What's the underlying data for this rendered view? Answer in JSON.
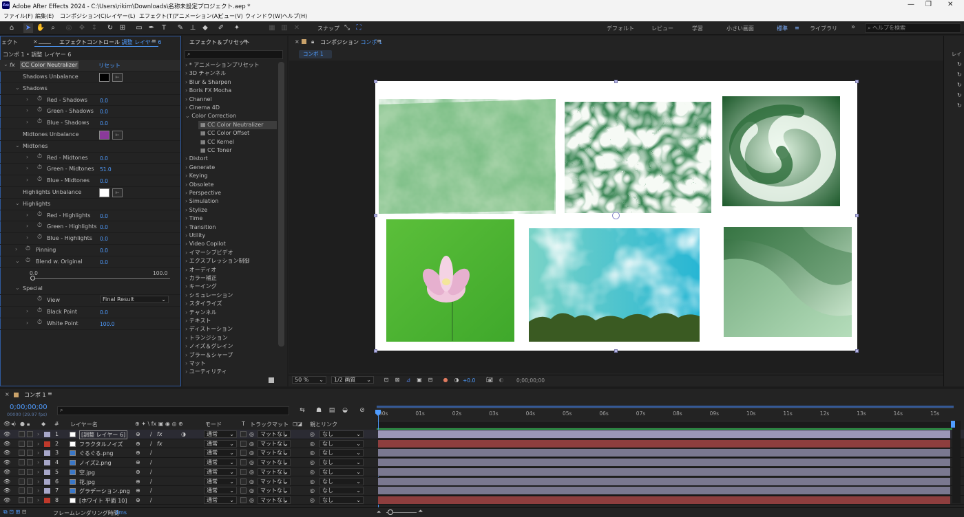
{
  "window": {
    "title": "Adobe After Effects 2024 - C:\\Users\\rikim\\Downloads\\名称未設定プロジェクト.aep *",
    "logo_text": "Ae",
    "minimize": "—",
    "maximize": "❐",
    "close": "✕"
  },
  "menu": [
    "ファイル(F)",
    "編集(E)",
    "コンポジション(C)",
    "レイヤー(L)",
    "エフェクト(T)",
    "アニメーション(A)",
    "ビュー(V)",
    "ウィンドウ(W)",
    "ヘルプ(H)"
  ],
  "toolbar": {
    "snap_label": "スナップ",
    "workspaces": [
      "デフォルト",
      "レビュー",
      "学習",
      "小さい画面",
      "標準",
      "ライブラリ"
    ],
    "active_workspace": "標準",
    "more": "»",
    "help_search_placeholder": "ヘルプを検索"
  },
  "effect_controls": {
    "left_stub": "ェクト",
    "tab_label": "エフェクトコントロール",
    "tab_layer": "調整 レイヤー 6",
    "breadcrumb": "コンポ 1 • 調整 レイヤー 6",
    "effect_name": "CC Color Neutralizer",
    "reset": "リセット",
    "rows": [
      {
        "label": "Shadows Unbalance",
        "kind": "color",
        "color": "#000000"
      },
      {
        "label": "Shadows",
        "kind": "group"
      },
      {
        "label": "Red - Shadows",
        "kind": "param",
        "value": "0.0"
      },
      {
        "label": "Green - Shadows",
        "kind": "param",
        "value": "0.0"
      },
      {
        "label": "Blue - Shadows",
        "kind": "param",
        "value": "0.0"
      },
      {
        "label": "Midtones Unbalance",
        "kind": "color",
        "color": "#8a3a9a"
      },
      {
        "label": "Midtones",
        "kind": "group"
      },
      {
        "label": "Red - Midtones",
        "kind": "param",
        "value": "0.0"
      },
      {
        "label": "Green - Midtones",
        "kind": "param",
        "value": "51.0"
      },
      {
        "label": "Blue - Midtones",
        "kind": "param",
        "value": "0.0"
      },
      {
        "label": "Highlights Unbalance",
        "kind": "color",
        "color": "#ffffff"
      },
      {
        "label": "Highlights",
        "kind": "group"
      },
      {
        "label": "Red - Highlights",
        "kind": "param",
        "value": "0.0"
      },
      {
        "label": "Green - Highlights",
        "kind": "param",
        "value": "0.0"
      },
      {
        "label": "Blue - Highlights",
        "kind": "param",
        "value": "0.0"
      },
      {
        "label": "Pinning",
        "kind": "top",
        "value": "0.0"
      },
      {
        "label": "Blend w. Original",
        "kind": "top",
        "value": "0.0"
      }
    ],
    "slider": {
      "min": "0.0",
      "max": "100.0",
      "value": 0
    },
    "special_label": "Special",
    "view_label": "View",
    "view_value": "Final Result",
    "black_point_label": "Black Point",
    "black_point_value": "0.0",
    "white_point_label": "White Point",
    "white_point_value": "100.0"
  },
  "effects_presets": {
    "tab_label": "エフェクト＆プリセット",
    "search_icon": "⌕",
    "items": [
      {
        "label": "* アニメーションプリセット",
        "level": 0,
        "open": false
      },
      {
        "label": "3D チャンネル",
        "level": 0,
        "open": false
      },
      {
        "label": "Blur & Sharpen",
        "level": 0,
        "open": false
      },
      {
        "label": "Boris FX Mocha",
        "level": 0,
        "open": false
      },
      {
        "label": "Channel",
        "level": 0,
        "open": false
      },
      {
        "label": "Cinema 4D",
        "level": 0,
        "open": false
      },
      {
        "label": "Color Correction",
        "level": 0,
        "open": true
      },
      {
        "label": "CC Color Neutralizer",
        "level": 1,
        "selected": true
      },
      {
        "label": "CC Color Offset",
        "level": 1
      },
      {
        "label": "CC Kernel",
        "level": 1
      },
      {
        "label": "CC Toner",
        "level": 1
      },
      {
        "label": "Distort",
        "level": 0
      },
      {
        "label": "Generate",
        "level": 0
      },
      {
        "label": "Keying",
        "level": 0
      },
      {
        "label": "Obsolete",
        "level": 0
      },
      {
        "label": "Perspective",
        "level": 0
      },
      {
        "label": "Simulation",
        "level": 0
      },
      {
        "label": "Stylize",
        "level": 0
      },
      {
        "label": "Time",
        "level": 0
      },
      {
        "label": "Transition",
        "level": 0
      },
      {
        "label": "Utility",
        "level": 0
      },
      {
        "label": "Video Copilot",
        "level": 0
      },
      {
        "label": "イマーシブビデオ",
        "level": 0
      },
      {
        "label": "エクスプレッション制御",
        "level": 0
      },
      {
        "label": "オーディオ",
        "level": 0
      },
      {
        "label": "カラー補正",
        "level": 0
      },
      {
        "label": "キーイング",
        "level": 0
      },
      {
        "label": "シミュレーション",
        "level": 0
      },
      {
        "label": "スタイライズ",
        "level": 0
      },
      {
        "label": "チャンネル",
        "level": 0
      },
      {
        "label": "テキスト",
        "level": 0
      },
      {
        "label": "ディストーション",
        "level": 0
      },
      {
        "label": "トランジション",
        "level": 0
      },
      {
        "label": "ノイズ＆グレイン",
        "level": 0
      },
      {
        "label": "ブラー＆シャープ",
        "level": 0
      },
      {
        "label": "マット",
        "level": 0
      },
      {
        "label": "ユーティリティ",
        "level": 0
      }
    ]
  },
  "composition": {
    "tab_label": "コンポジション",
    "tab_comp": "コンポ 1",
    "subtab": "コンポ 1",
    "zoom": "50 %",
    "quality": "1/2 画質",
    "exposure": "+0.0",
    "timecode": "0;00;00;00"
  },
  "timeline": {
    "tab": "コンポ 1",
    "timecode": "0;00;00;00",
    "fps": "00000 (29.97 fps)",
    "col_layer_name": "レイヤー名",
    "col_mode": "モード",
    "col_t": "T",
    "col_trackmatte": "トラックマット",
    "col_parent": "親とリンク",
    "ruler": [
      "00s",
      "01s",
      "02s",
      "03s",
      "04s",
      "05s",
      "06s",
      "07s",
      "08s",
      "09s",
      "10s",
      "11s",
      "12s",
      "13s",
      "14s",
      "15s"
    ],
    "layers": [
      {
        "num": "1",
        "name": "[調整 レイヤー 6]",
        "label_color": "#a7a7c9",
        "mode": "通常",
        "matte": "マットなし",
        "parent": "なし",
        "fx": true,
        "bar_color": "#9b97b8"
      },
      {
        "num": "2",
        "name": "フラクタルノイズ",
        "label_color": "#c0392b",
        "mode": "通常",
        "matte": "マットなし",
        "parent": "なし",
        "fx": true,
        "bar_color": "#8e3e3e"
      },
      {
        "num": "3",
        "name": "ぐるぐる.png",
        "label_color": "#a7a7c9",
        "mode": "通常",
        "matte": "マットなし",
        "parent": "なし",
        "fx": false,
        "bar_color": "#7a7890"
      },
      {
        "num": "4",
        "name": "ノイズ2.png",
        "label_color": "#a7a7c9",
        "mode": "通常",
        "matte": "マットなし",
        "parent": "なし",
        "fx": false,
        "bar_color": "#7a7890"
      },
      {
        "num": "5",
        "name": "空.jpg",
        "label_color": "#a7a7c9",
        "mode": "通常",
        "matte": "マットなし",
        "parent": "なし",
        "fx": false,
        "bar_color": "#7a7890"
      },
      {
        "num": "6",
        "name": "花.jpg",
        "label_color": "#a7a7c9",
        "mode": "通常",
        "matte": "マットなし",
        "parent": "なし",
        "fx": false,
        "bar_color": "#7a7890"
      },
      {
        "num": "7",
        "name": "グラデーション.png",
        "label_color": "#a7a7c9",
        "mode": "通常",
        "matte": "マットなし",
        "parent": "なし",
        "fx": false,
        "bar_color": "#7a7890"
      },
      {
        "num": "8",
        "name": "[ホワイト 平面 10]",
        "label_color": "#c0392b",
        "mode": "通常",
        "matte": "マットなし",
        "parent": "なし",
        "fx": false,
        "bar_color": "#8e3e3e"
      }
    ],
    "render_time_label": "フレームレンダリング時間",
    "render_time_value": "4ms"
  }
}
